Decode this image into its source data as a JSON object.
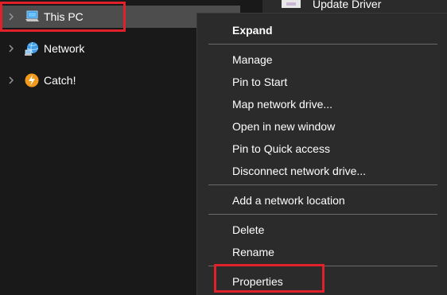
{
  "nav": {
    "items": [
      {
        "label": "This PC",
        "icon": "computer-icon",
        "selected": true
      },
      {
        "label": "Network",
        "icon": "network-icon"
      },
      {
        "label": "Catch!",
        "icon": "catch-app-icon"
      }
    ]
  },
  "peek": {
    "label": "Update Driver",
    "icon": "update-driver-icon"
  },
  "context_menu": {
    "items": [
      {
        "label": "Expand",
        "bold": true
      },
      {
        "label": "Manage"
      },
      {
        "label": "Pin to Start"
      },
      {
        "label": "Map network drive..."
      },
      {
        "label": "Open in new window"
      },
      {
        "label": "Pin to Quick access"
      },
      {
        "label": "Disconnect network drive..."
      },
      {
        "label": "Add a network location"
      },
      {
        "label": "Delete"
      },
      {
        "label": "Rename"
      },
      {
        "label": "Properties"
      }
    ]
  },
  "colors": {
    "background": "#191919",
    "menu_background": "#2b2b2b",
    "selection": "#4d4d4d",
    "highlight_box": "#e0202a",
    "separator": "#6a6a6a",
    "text": "#ffffff"
  }
}
